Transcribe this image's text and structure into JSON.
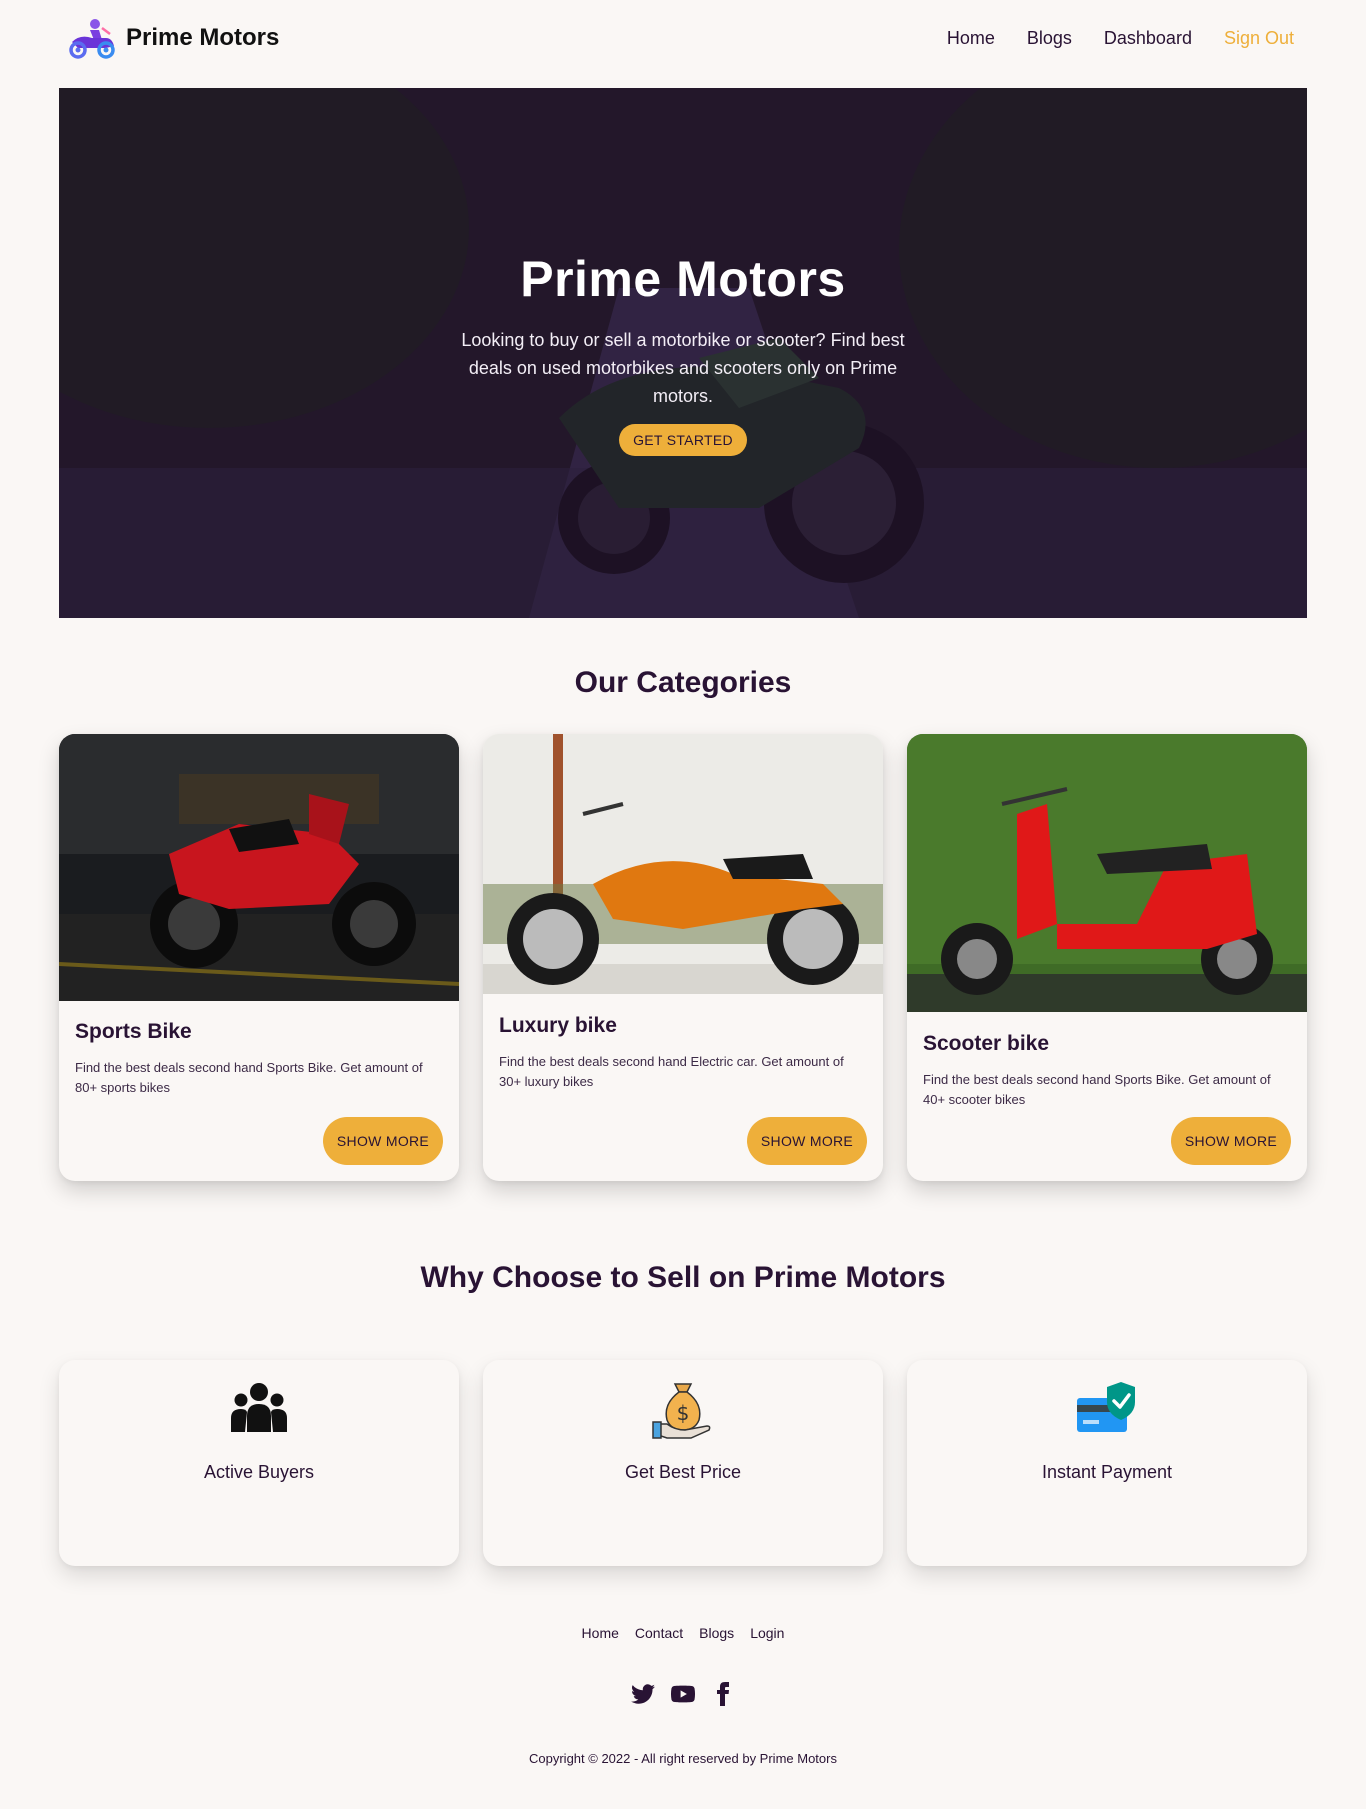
{
  "brand": {
    "name": "Prime Motors",
    "logo_icon": "motorbike-rider-icon"
  },
  "nav": {
    "links": [
      "Home",
      "Blogs",
      "Dashboard"
    ],
    "sign_out": "Sign Out"
  },
  "hero": {
    "title": "Prime Motors",
    "text": "Looking to buy or sell a motorbike or scooter? Find best deals on used motorbikes and scooters only on Prime motors.",
    "button": "GET STARTED"
  },
  "categories": {
    "title": "Our Categories",
    "items": [
      {
        "title": "Sports Bike",
        "desc": "Find the best deals second hand Sports Bike. Get amount of 80+ sports bikes",
        "button": "SHOW MORE",
        "image": "red-sports-bike"
      },
      {
        "title": "Luxury bike",
        "desc": "Find the best deals second hand Electric car. Get amount of 30+ luxury bikes",
        "button": "SHOW MORE",
        "image": "orange-cruiser-bike"
      },
      {
        "title": "Scooter bike",
        "desc": "Find the best deals second hand Sports Bike. Get amount of 40+ scooter bikes",
        "button": "SHOW MORE",
        "image": "red-scooter"
      }
    ]
  },
  "why": {
    "title": "Why Choose to Sell on Prime Motors",
    "items": [
      {
        "label": "Active Buyers",
        "icon": "users-group-icon"
      },
      {
        "label": "Get Best Price",
        "icon": "money-bag-hand-icon"
      },
      {
        "label": "Instant Payment",
        "icon": "card-shield-icon"
      }
    ]
  },
  "footer": {
    "links": [
      "Home",
      "Contact",
      "Blogs",
      "Login"
    ],
    "socials": [
      "twitter-icon",
      "youtube-icon",
      "facebook-icon"
    ],
    "copyright": "Copyright © 2022 - All right reserved by Prime Motors"
  },
  "colors": {
    "accent": "#eeaf3a",
    "text": "#291334",
    "background": "#faf7f5"
  }
}
